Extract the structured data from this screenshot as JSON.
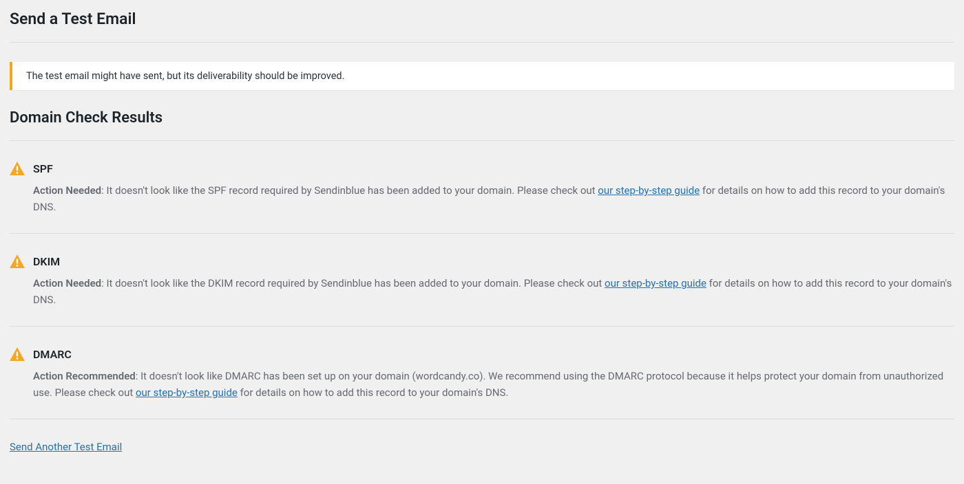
{
  "page_title": "Send a Test Email",
  "alert_message": "The test email might have sent, but its deliverability should be improved.",
  "results_heading": "Domain Check Results",
  "results": [
    {
      "name": "SPF",
      "action_label": "Action Needed",
      "description_before": ": It doesn't look like the SPF record required by Sendinblue has been added to your domain. Please check out ",
      "guide_link_text": "our step-by-step guide",
      "description_after": " for details on how to add this record to your domain's DNS."
    },
    {
      "name": "DKIM",
      "action_label": "Action Needed",
      "description_before": ": It doesn't look like the DKIM record required by Sendinblue has been added to your domain. Please check out ",
      "guide_link_text": "our step-by-step guide",
      "description_after": " for details on how to add this record to your domain's DNS."
    },
    {
      "name": "DMARC",
      "action_label": "Action Recommended",
      "description_before": ": It doesn't look like DMARC has been set up on your domain (wordcandy.co). We recommend using the DMARC protocol because it helps protect your domain from unauthorized use. Please check out ",
      "guide_link_text": "our step-by-step guide",
      "description_after": " for details on how to add this record to your domain's DNS."
    }
  ],
  "send_another_label": "Send Another Test Email"
}
